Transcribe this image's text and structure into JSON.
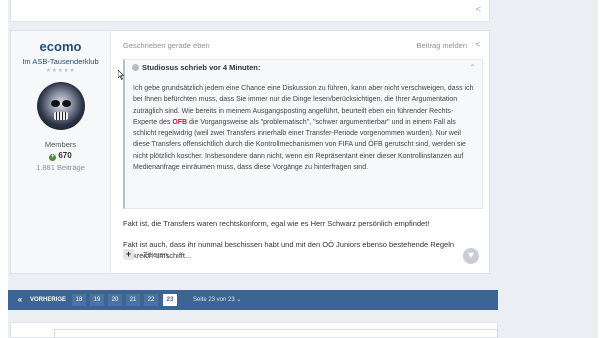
{
  "post": {
    "author": "ecomo",
    "group": "Im ASB-Tausenderklub",
    "stars": "★★★★★",
    "rank": "Members",
    "reputation": "670",
    "post_count": "1.881 Beiträge",
    "timestamp": "Geschrieben gerade eben",
    "report_label": "Beitrag melden",
    "quote": {
      "header": "Studiosus schrieb vor 4 Minuten:",
      "text_part1": "Ich gebe grundsätzlich jedem eine Chance eine Diskussion zu führen, kann aber nicht verschweigen, dass ich bei Ihnen befürchten muss, dass Sie immer nur die Dinge lesen/berücksichtigen, die Ihrer Argumentation zuträglich sind. Wie bereits in meinem Ausgangsposting angeführt, beurteilt eben ein führender Rechts-Experte des ",
      "highlight": "OFB",
      "text_part2": " die Vorgangsweise als \"problematisch\", \"schwer argumentierbar\" und in einem Fall als schlicht regelwidrig (weil zwei Transfers innerhalb einer Transfer-Periode vorgenommen wurden). Nur weil diese Transfers offensichtlich durch die Kontrollmechanismen von FIFA und ÖFB gerutscht sind, werden sie nicht plötzlich koscher. Insbesondere dann nicht, wenn ein Repräsentant einer dieser Kontrollinstanzen auf Medienanfrage einräumen muss, dass diese Vorgänge zu hinterfragen sind."
    },
    "reply1": "Fakt ist, die Transfers waren rechtskonform, egal wie es Herr Schwarz persönlich empfindet!",
    "reply2": "Fakt ist auch, dass ihr nunmal beschissen habt und mit den OÖ Juniors ebenso bestehende Regeln trickreich umschifft...",
    "quote_button": "Zitieren"
  },
  "pager": {
    "prev_label": "VORHERIGE",
    "pages": [
      "18",
      "19",
      "20",
      "21",
      "22",
      "23"
    ],
    "current": "23",
    "page_of": "Seite 23 von 23"
  },
  "colors": {
    "accent": "#3d6594",
    "author": "#1f4d7a",
    "highlight": "#b0243a"
  }
}
